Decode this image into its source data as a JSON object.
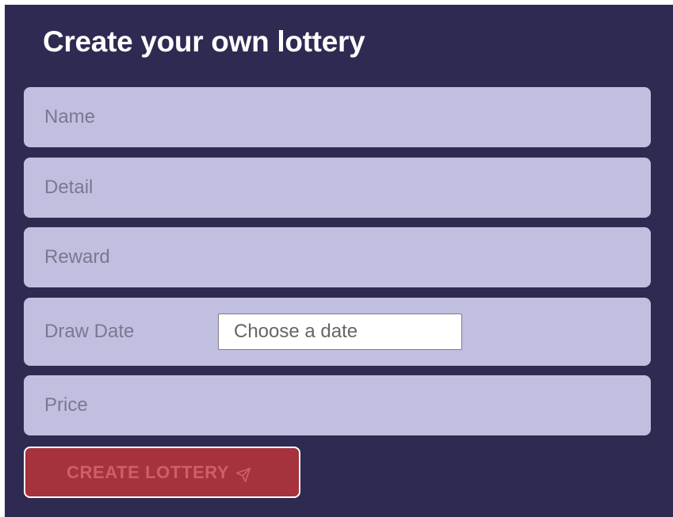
{
  "form": {
    "title": "Create your own lottery",
    "name_placeholder": "Name",
    "detail_placeholder": "Detail",
    "reward_placeholder": "Reward",
    "draw_date_label": "Draw Date",
    "draw_date_placeholder": "Choose a date",
    "price_placeholder": "Price",
    "submit_label": "CREATE LOTTERY",
    "submit_icon": "send-icon"
  },
  "colors": {
    "panel_background": "#2e2a51",
    "field_background": "#c1bfe0",
    "button_background": "#a5323c",
    "button_text": "#d05d6a"
  }
}
